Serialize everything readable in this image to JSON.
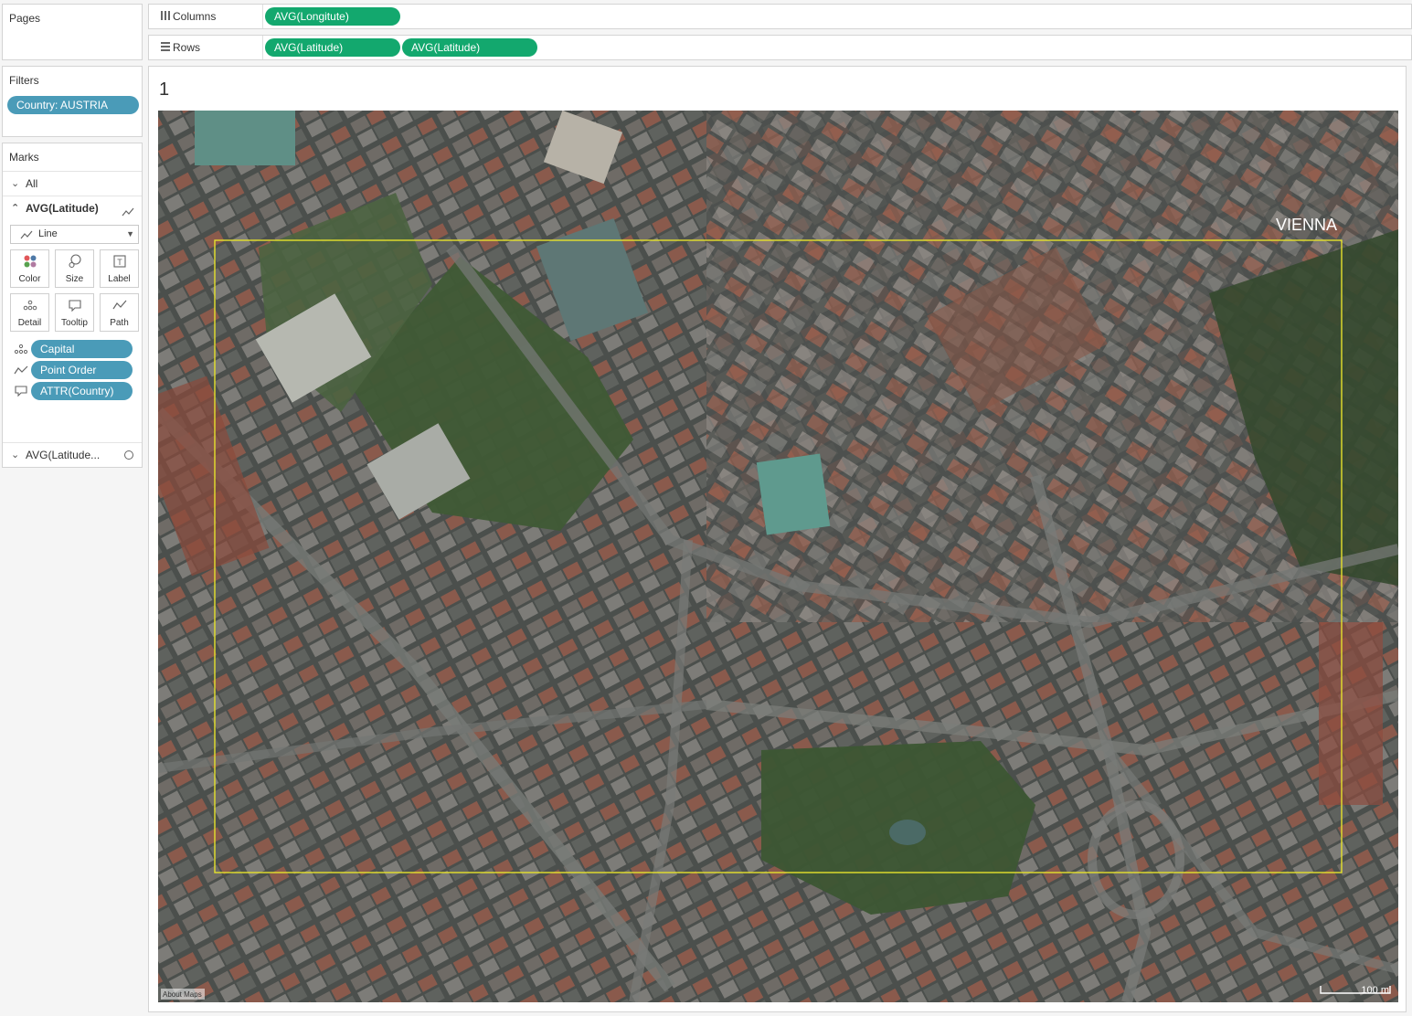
{
  "pages_card": {
    "title": "Pages"
  },
  "filters_card": {
    "title": "Filters",
    "filter_pill": "Country: AUSTRIA"
  },
  "marks_card": {
    "title": "Marks",
    "all_label": "All",
    "layer1_label": "AVG(Latitude)",
    "mark_type": "Line",
    "buttons": {
      "color": "Color",
      "size": "Size",
      "label": "Label",
      "detail": "Detail",
      "tooltip": "Tooltip",
      "path": "Path"
    },
    "fields": {
      "detail": "Capital",
      "path": "Point Order",
      "tooltip": "ATTR(Country)"
    },
    "layer2_label": "AVG(Latitude..."
  },
  "columns_shelf": {
    "label": "Columns",
    "pills": [
      "AVG(Longitute)"
    ]
  },
  "rows_shelf": {
    "label": "Rows",
    "pills": [
      "AVG(Latitude)",
      "AVG(Latitude)"
    ]
  },
  "view": {
    "title": "1",
    "city_label": "VIENNA",
    "attribution": "About Maps",
    "scale_label": "100 m",
    "outline_color": "#e6e22c",
    "pill_blue": "#4a9bb8",
    "pill_green": "#13a86e"
  }
}
